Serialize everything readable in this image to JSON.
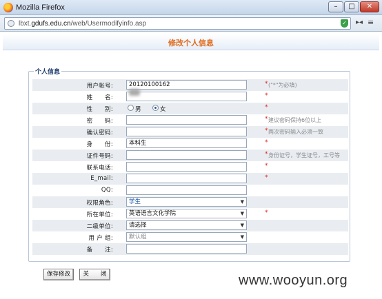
{
  "window": {
    "title": "Mozilla Firefox",
    "min": "–",
    "max": "□",
    "close": "✕"
  },
  "address": {
    "url_prefix": "lbxt.",
    "url_domain": "gdufs.edu.cn",
    "url_path": "/web/Usermodifyinfo.asp"
  },
  "page": {
    "title": "修改个人信息",
    "legend": "个人信息"
  },
  "form": {
    "rows": {
      "account": {
        "label": "用户帐号:",
        "value": "20120100162",
        "req": "*",
        "hint": "(\"*\"为必填)"
      },
      "name": {
        "label": "姓　　名:",
        "value": "",
        "req": "*"
      },
      "gender": {
        "label": "性　　别:",
        "male": "男",
        "female": "女",
        "selected": "女",
        "req": "*"
      },
      "password": {
        "label": "密　　码:",
        "value": "",
        "req": "*",
        "hint": "建议密码保持6位以上"
      },
      "confirm": {
        "label": "确认密码:",
        "value": "",
        "req": "*",
        "hint": "两次密码输入必须一致"
      },
      "identity": {
        "label": "身　　份:",
        "value": "本科生",
        "req": "*"
      },
      "idnum": {
        "label": "证件号码:",
        "value": "",
        "req": "*",
        "hint": "身份证号，学生证号，工号等"
      },
      "phone": {
        "label": "联系电话:",
        "value": "",
        "req": "*"
      },
      "email": {
        "label": "E_mail:",
        "value": "",
        "req": "*"
      },
      "qq": {
        "label": "QQ:",
        "value": ""
      },
      "role": {
        "label": "权限角色:",
        "value": "学生"
      },
      "unit": {
        "label": "所在单位:",
        "value": "英语语言文化学院",
        "req": "*"
      },
      "subunit": {
        "label": "二级单位:",
        "value": "请选择"
      },
      "usergroup": {
        "label": "用 户 组:",
        "value": "默认组"
      },
      "remark": {
        "label": "备　　注:",
        "value": ""
      }
    }
  },
  "buttons": {
    "save": "保存修改",
    "close": "关　　闭"
  },
  "watermark": "www.wooyun.org",
  "colors": {
    "title": "#e06a1b",
    "required": "#e0231a",
    "row_alt": "#e9edf1"
  }
}
